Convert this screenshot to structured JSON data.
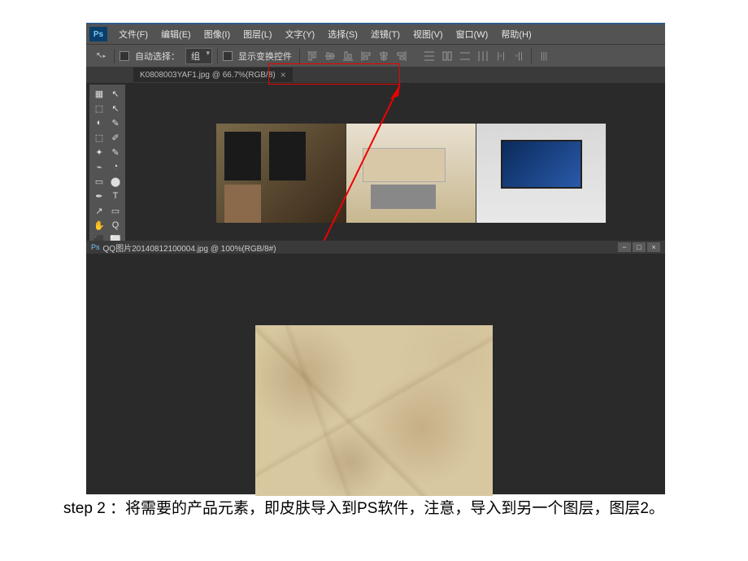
{
  "ps": {
    "logo": "Ps",
    "menu": [
      "文件(F)",
      "编辑(E)",
      "图像(I)",
      "图层(L)",
      "文字(Y)",
      "选择(S)",
      "滤镜(T)",
      "视图(V)",
      "窗口(W)",
      "帮助(H)"
    ],
    "options": {
      "auto_select_label": "自动选择：",
      "group_select": "组",
      "show_transform_label": "显示变换控件"
    },
    "tab1": {
      "title": "K0808003YAF1.jpg @ 66.7%(RGB/8)"
    },
    "tab2": {
      "title": "QQ图片20140812100004.jpg @ 100%(RGB/8#)"
    },
    "tools": [
      [
        "▦",
        "↖"
      ],
      [
        "⬚",
        "↖"
      ],
      [
        "◐",
        "✎"
      ],
      [
        "⬚",
        "✐"
      ],
      [
        "✦",
        "✎"
      ],
      [
        "⌁",
        "◔"
      ],
      [
        "▭",
        "⬤"
      ],
      [
        "✒",
        "T"
      ],
      [
        "↗",
        "▭"
      ],
      [
        "✋",
        "Q"
      ],
      [
        "⬛",
        "⬜"
      ],
      [
        "◪",
        ""
      ]
    ],
    "window_controls": [
      "−",
      "□",
      "×"
    ]
  },
  "caption": "step 2 ：将需要的产品元素，即皮肤导入到PS软件，注意，导入到另一个图层，图层2。"
}
